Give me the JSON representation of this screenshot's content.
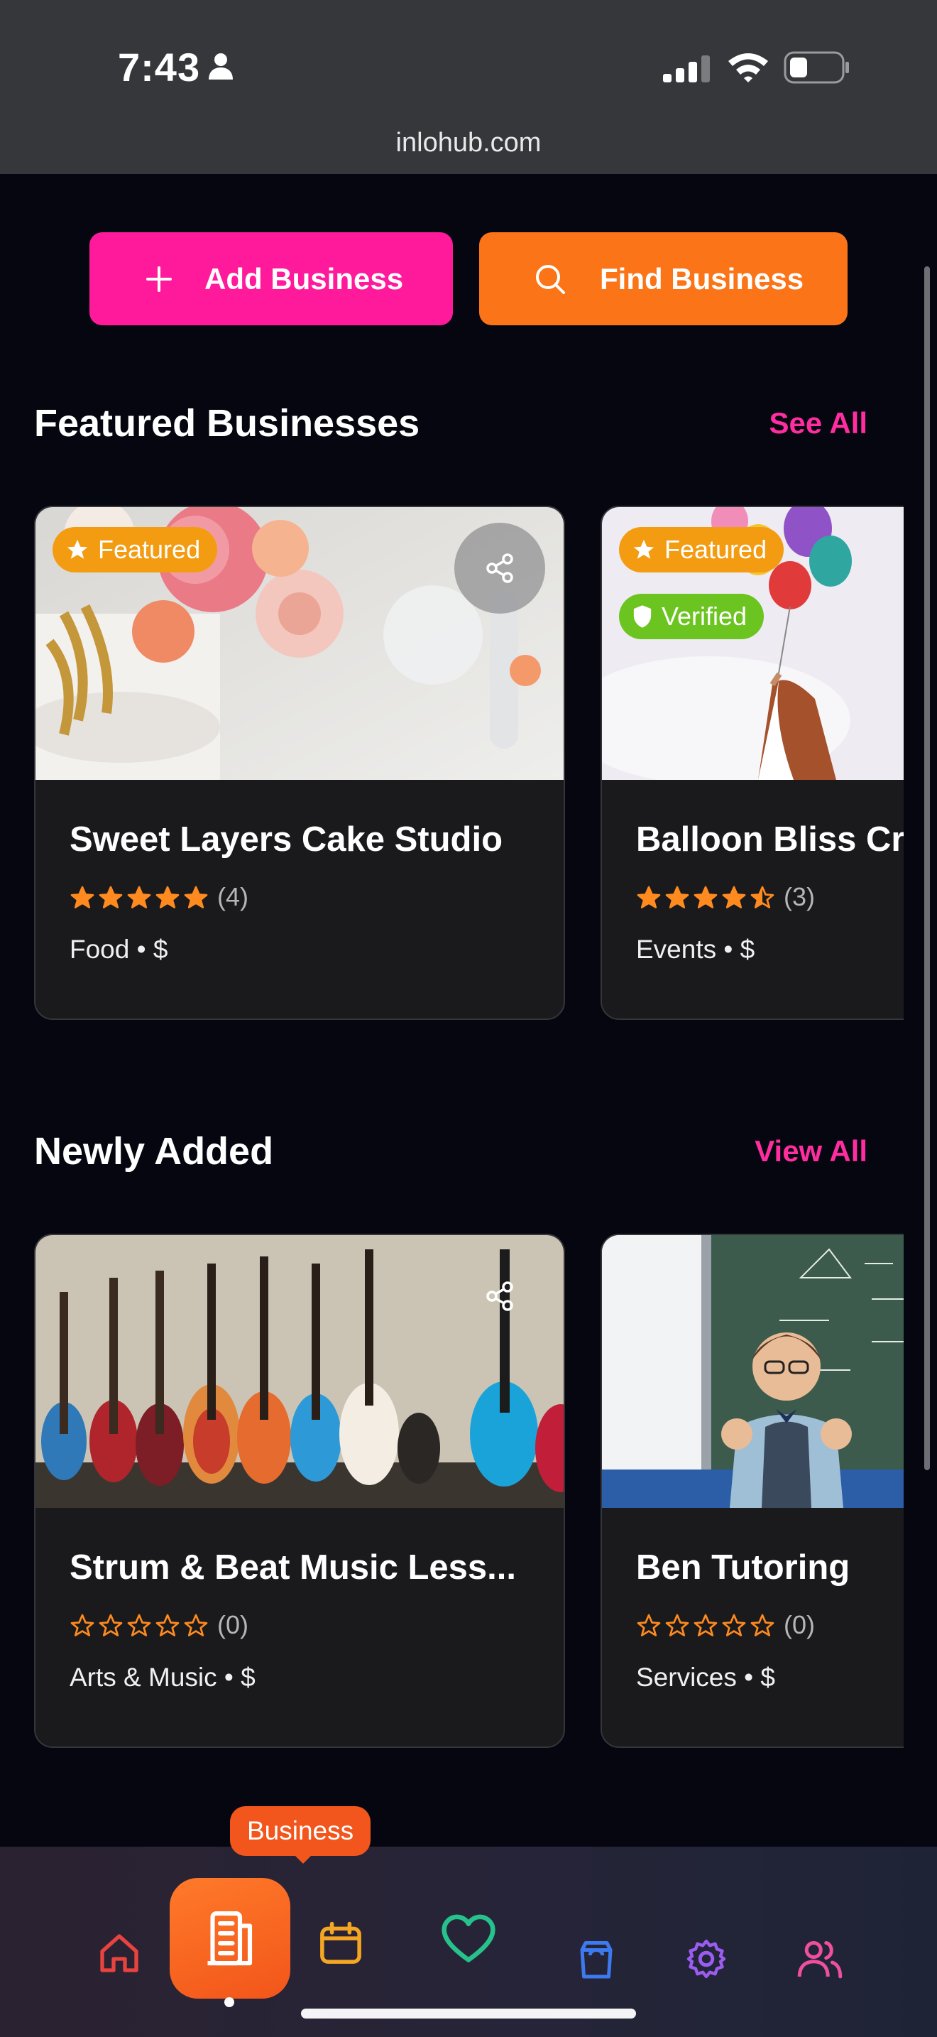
{
  "status_bar": {
    "time": "7:43",
    "url": "inlohub.com"
  },
  "actions": {
    "add_label": "Add Business",
    "find_label": "Find Business"
  },
  "featured": {
    "title": "Featured Businesses",
    "link": "See All",
    "cards": [
      {
        "name": "Sweet Layers Cake Studio",
        "rating": 5,
        "count": "(4)",
        "meta": "Food • $",
        "badges": [
          "Featured"
        ]
      },
      {
        "name": "Balloon Bliss Creations",
        "rating": 4.5,
        "count": "(3)",
        "meta": "Events • $",
        "badges": [
          "Featured",
          "Verified"
        ]
      }
    ]
  },
  "newly_added": {
    "title": "Newly Added",
    "link": "View All",
    "cards": [
      {
        "name": "Strum & Beat Music Less...",
        "rating": 0,
        "count": "(0)",
        "meta": "Arts & Music • $"
      },
      {
        "name": "Ben Tutoring",
        "rating": 0,
        "count": "(0)",
        "meta": "Services • $"
      }
    ]
  },
  "bottom_nav": {
    "tooltip": "Business",
    "items": [
      "home-icon",
      "business-icon",
      "calendar-icon",
      "heart-icon",
      "bag-icon",
      "gear-icon",
      "users-icon"
    ]
  },
  "colors": {
    "pink": "#ff1a9c",
    "orange": "#fb7417",
    "star": "#ff8a1f",
    "verified": "#6bc420",
    "featured": "#f39c12"
  }
}
